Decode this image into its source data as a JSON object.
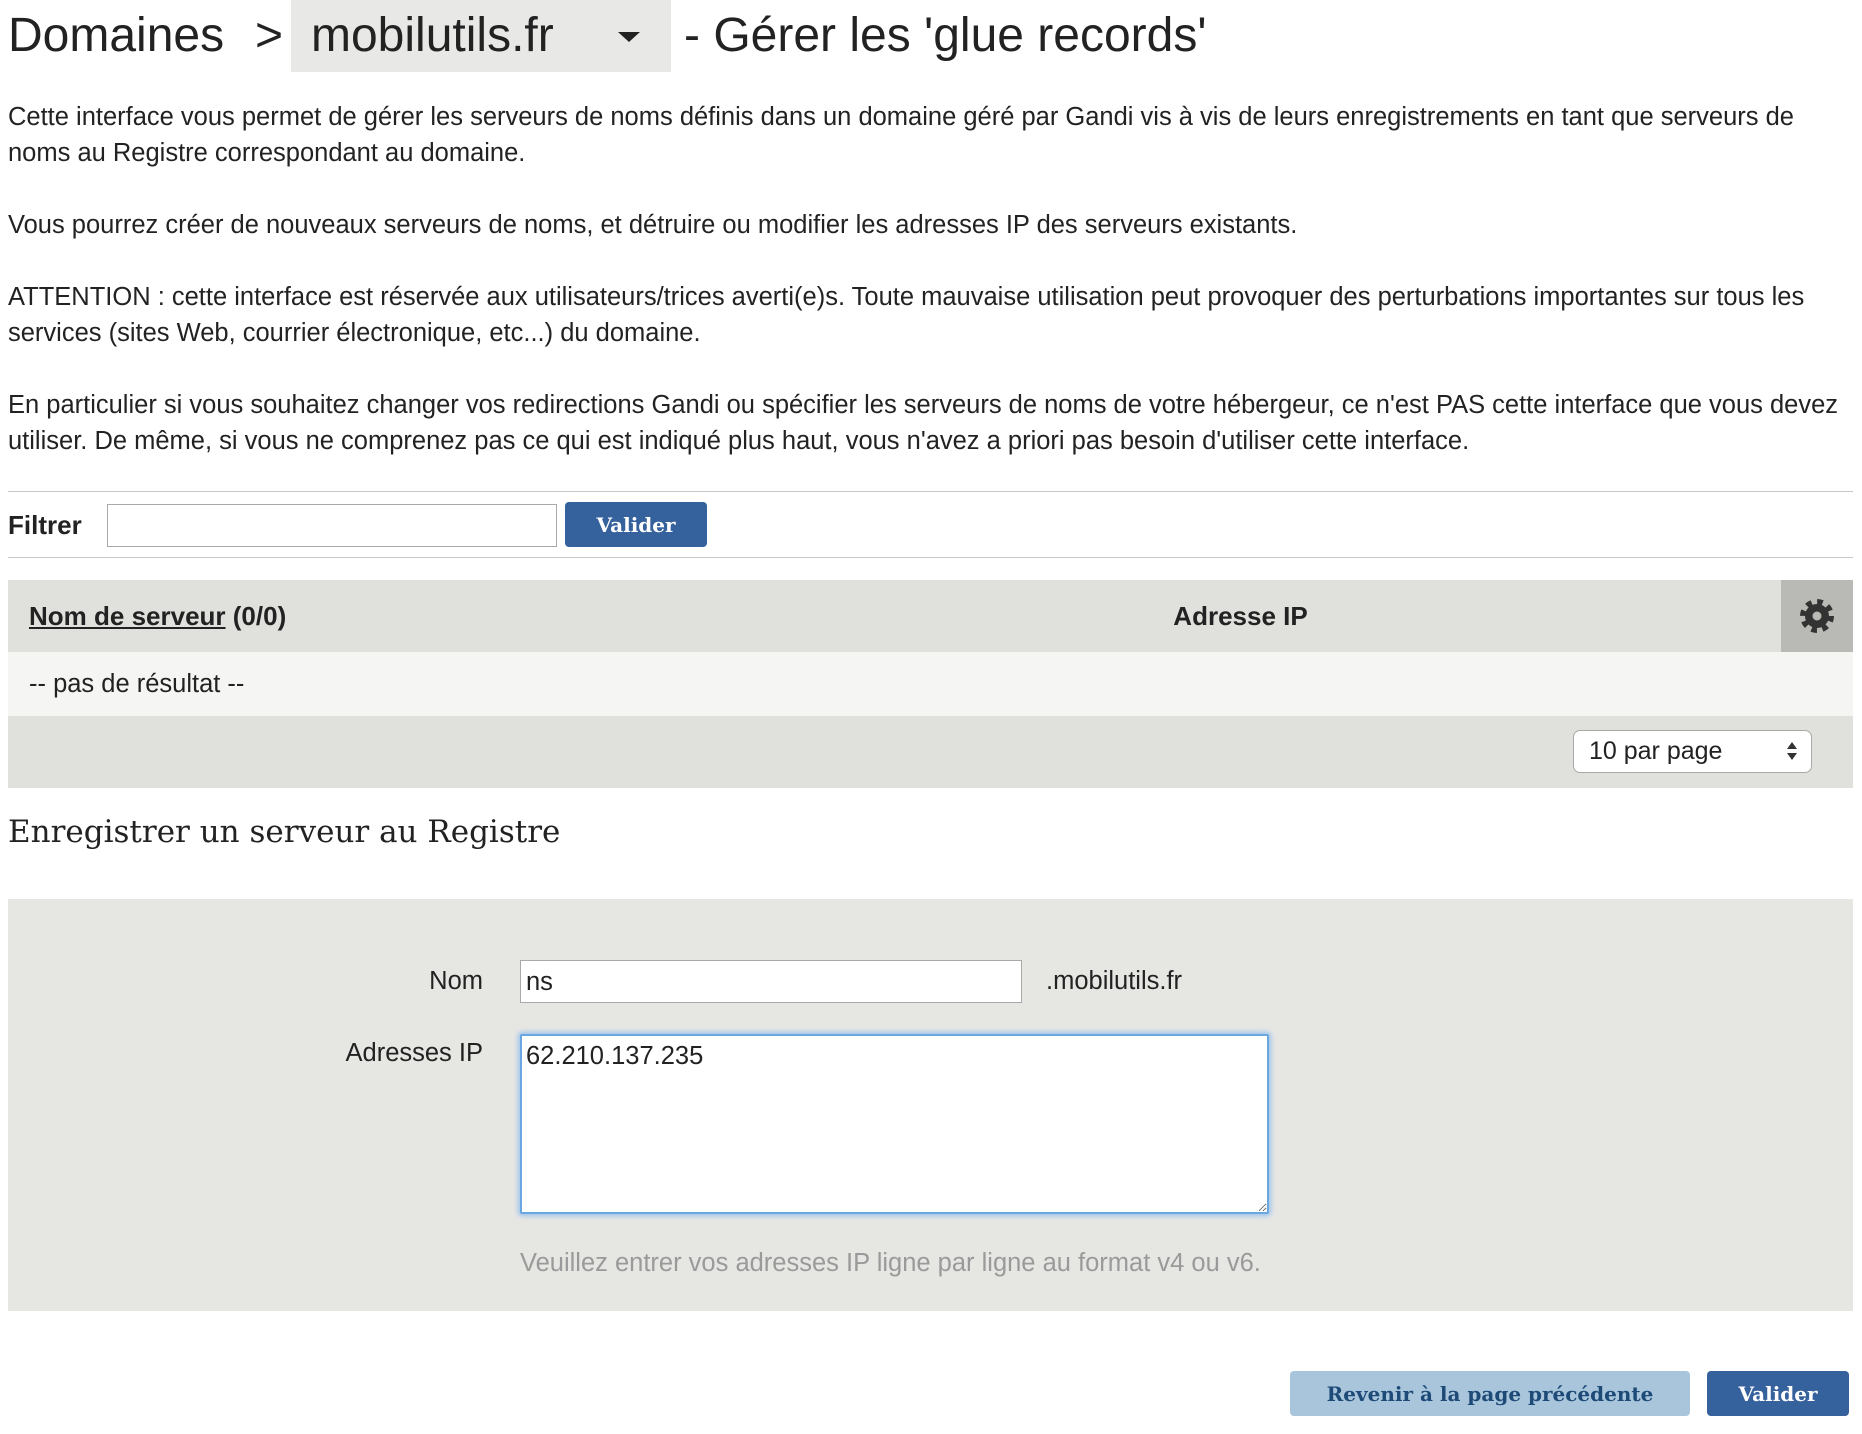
{
  "title": {
    "section": "Domaines",
    "separator": ">",
    "domain": "mobilutils.fr",
    "suffix": "- Gérer les 'glue records'"
  },
  "intro": [
    "Cette interface vous permet de gérer les serveurs de noms définis dans un domaine géré par Gandi vis à vis de leurs enregistrements en tant que serveurs de noms au Registre correspondant au domaine.",
    "Vous pourrez créer de nouveaux serveurs de noms, et détruire ou modifier les adresses IP des serveurs existants.",
    "ATTENTION : cette interface est réservée aux utilisateurs/trices averti(e)s. Toute mauvaise utilisation peut provoquer des perturbations importantes sur tous les services (sites Web, courrier électronique, etc...) du domaine.",
    "En particulier si vous souhaitez changer vos redirections Gandi ou spécifier les serveurs de noms de votre hébergeur, ce n'est PAS cette interface que vous devez utiliser. De même, si vous ne comprenez pas ce qui est indiqué plus haut, vous n'avez a priori pas besoin d'utiliser cette interface."
  ],
  "filter": {
    "label": "Filtrer",
    "value": "",
    "button": "Valider"
  },
  "table": {
    "col_name": "Nom de serveur",
    "col_name_count": "(0/0)",
    "col_ip": "Adresse IP",
    "empty_message": "-- pas de résultat --",
    "per_page": "10 par page"
  },
  "register": {
    "heading": "Enregistrer un serveur au Registre",
    "name_label": "Nom",
    "name_value": "ns",
    "domain_suffix": ".mobilutils.fr",
    "ip_label": "Adresses IP",
    "ip_value": "62.210.137.235",
    "help": "Veuillez entrer vos adresses IP ligne par ligne au format v4 ou v6."
  },
  "actions": {
    "back": "Revenir à la page précédente",
    "submit": "Valider"
  },
  "icons": {
    "domain_dropdown": "chevron-down-icon",
    "table_settings": "gear-icon",
    "per_page_select": "select-arrows-icon"
  },
  "colors": {
    "primary_button": "#35619c",
    "secondary_button": "#a8c5db",
    "secondary_button_text": "#1d4a77",
    "table_header": "#e0e0dc",
    "form_panel": "#e6e6e3",
    "focus_border": "#6aa6e0",
    "help_text": "#9a9a9a"
  }
}
